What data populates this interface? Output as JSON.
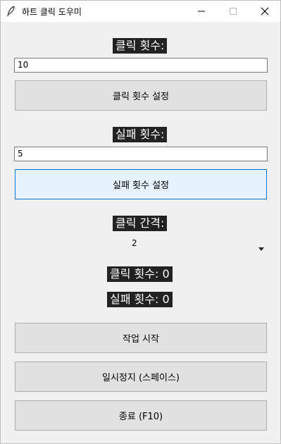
{
  "window": {
    "title": "하트 클릭 도우미"
  },
  "click_count": {
    "label": "클릭 횟수:",
    "value": "10",
    "button": "클릭 횟수 설정"
  },
  "fail_count": {
    "label": "실패 횟수:",
    "value": "5",
    "button": "실패 횟수 설정"
  },
  "interval": {
    "label": "클릭 간격:",
    "selected": "2"
  },
  "status": {
    "clicks": "클릭 횟수: 0",
    "fails": "실패 횟수: 0"
  },
  "actions": {
    "start": "작업 시작",
    "pause": "일시정지 (스페이스)",
    "quit": "종료 (F10)"
  }
}
